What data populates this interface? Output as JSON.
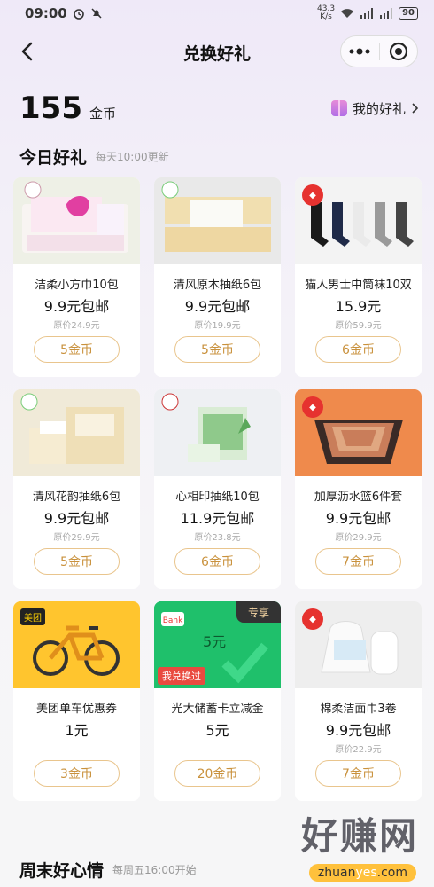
{
  "status_bar": {
    "time": "09:00",
    "speed_value": "43.3",
    "speed_unit": "K/s",
    "battery": "90"
  },
  "header": {
    "title": "兑换好礼"
  },
  "coins": {
    "count": "155",
    "unit": "金币",
    "my_gifts_label": "我的好礼"
  },
  "today": {
    "title": "今日好礼",
    "subtitle": "每天10:00更新"
  },
  "products": [
    {
      "name": "洁柔小方巾10包",
      "price": "9.9元包邮",
      "original": "原价24.9元",
      "button": "5金币"
    },
    {
      "name": "清风原木抽纸6包",
      "price": "9.9元包邮",
      "original": "原价19.9元",
      "button": "5金币"
    },
    {
      "name": "猫人男士中筒袜10双",
      "price": "15.9元",
      "original": "原价59.9元",
      "button": "6金币"
    },
    {
      "name": "清风花韵抽纸6包",
      "price": "9.9元包邮",
      "original": "原价29.9元",
      "button": "5金币"
    },
    {
      "name": "心相印抽纸10包",
      "price": "11.9元包邮",
      "original": "原价23.8元",
      "button": "6金币"
    },
    {
      "name": "加厚沥水篮6件套",
      "price": "9.9元包邮",
      "original": "原价29.9元",
      "button": "7金币"
    },
    {
      "name": "美团单车优惠券",
      "price": "1元",
      "original": "",
      "button": "3金币",
      "logo": "美团"
    },
    {
      "name": "光大储蓄卡立减金",
      "price": "5元",
      "original": "",
      "button": "20金币",
      "badge_exclusive": "专享",
      "badge_exchanged": "我兑换过",
      "card_amount": "5元"
    },
    {
      "name": "棉柔洁面巾3卷",
      "price": "9.9元包邮",
      "original": "原价22.9元",
      "button": "7金币"
    }
  ],
  "weekend": {
    "title": "周末好心情",
    "subtitle": "每周五16:00开始"
  },
  "watermark": {
    "text": "好赚网",
    "url_prefix": "zhuan",
    "url_highlight": "yes",
    "url_suffix": ".com"
  },
  "colors": {
    "button_border": "#e9c58d",
    "button_text": "#c9913c",
    "background_top": "#efe9f8"
  }
}
